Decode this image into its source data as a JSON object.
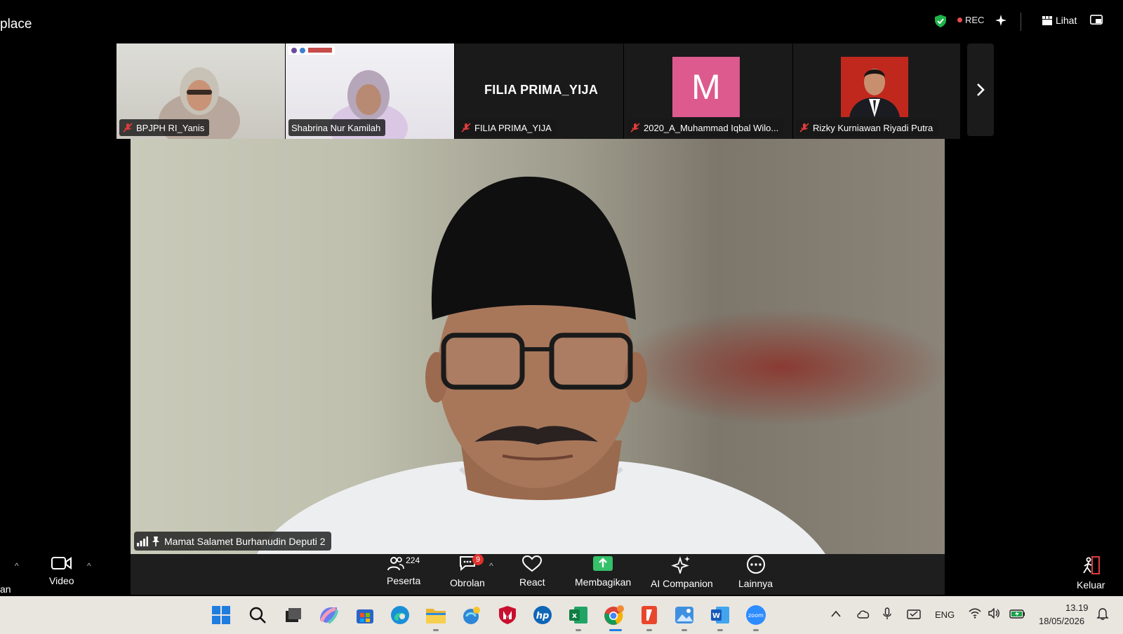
{
  "window": {
    "title": "place",
    "rec_label": "REC",
    "view_label": "Lihat"
  },
  "filmstrip": [
    {
      "name": "BPJPH RI_Yanis",
      "muted": true
    },
    {
      "name": "Shabrina Nur Kamilah",
      "muted": false
    },
    {
      "name": "FILIA PRIMA_YIJA",
      "muted": true,
      "display_text": "FILIA PRIMA_YIJA"
    },
    {
      "name": "2020_A_Muhammad Iqbal Wilo...",
      "muted": true,
      "avatar_letter": "M"
    },
    {
      "name": "Rizky Kurniawan Riyadi Putra",
      "muted": true
    }
  ],
  "speaker": {
    "name": "Mamat Salamet Burhanudin Deputi 2"
  },
  "toolbar": {
    "left_cut_label": "an",
    "video_label": "Video",
    "participants_label": "Peserta",
    "participants_count": "224",
    "chat_label": "Obrolan",
    "chat_badge": "9",
    "react_label": "React",
    "share_label": "Membagikan",
    "ai_label": "AI Companion",
    "more_label": "Lainnya",
    "leave_label": "Keluar"
  },
  "taskbar": {
    "language": "ENG",
    "time": "13.19",
    "date": "18/05/2026"
  },
  "colors": {
    "avatar_m": "#dc5a8d",
    "avatar_r": "#c0281e",
    "share_green": "#35c069",
    "badge_red": "#e0312c"
  }
}
